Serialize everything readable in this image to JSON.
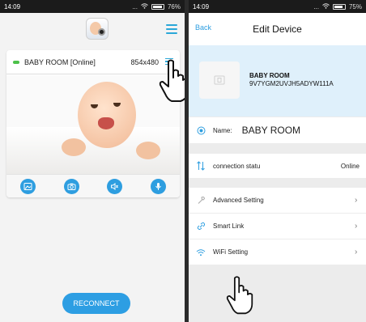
{
  "left_phone": {
    "status": {
      "time": "14:09",
      "signal": "...",
      "battery": "76%"
    },
    "camera": {
      "name": "BABY ROOM [Online]",
      "resolution": "854x480"
    },
    "toolbar": [
      "photo-icon",
      "camera-icon",
      "speaker-icon",
      "mic-icon"
    ],
    "reconnect_label": "RECONNECT"
  },
  "right_phone": {
    "status": {
      "time": "14:09",
      "signal": "...",
      "battery": "75%"
    },
    "header": {
      "back_label": "Back",
      "title": "Edit Device"
    },
    "device": {
      "name": "BABY ROOM",
      "uid": "9V7YGM2UVJH5ADYW111A"
    },
    "name_row": {
      "label": "Name:",
      "value": "BABY ROOM"
    },
    "connection_row": {
      "label": "connection statu",
      "value": "Online"
    },
    "menu": [
      {
        "label": "Advanced Setting",
        "icon": "wrench-icon"
      },
      {
        "label": "Smart Link",
        "icon": "link-icon"
      },
      {
        "label": "WiFi Setting",
        "icon": "wifi-icon"
      }
    ]
  },
  "colors": {
    "accent": "#2e9ee0",
    "online": "#4cc14a",
    "banner": "#dff0fb"
  }
}
